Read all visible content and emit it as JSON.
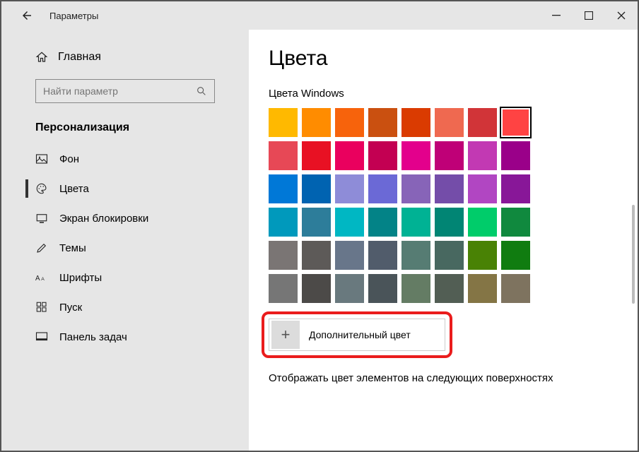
{
  "titlebar": {
    "title": "Параметры"
  },
  "sidebar": {
    "home": "Главная",
    "search_placeholder": "Найти параметр",
    "section": "Персонализация",
    "items": [
      {
        "label": "Фон"
      },
      {
        "label": "Цвета"
      },
      {
        "label": "Экран блокировки"
      },
      {
        "label": "Темы"
      },
      {
        "label": "Шрифты"
      },
      {
        "label": "Пуск"
      },
      {
        "label": "Панель задач"
      }
    ]
  },
  "main": {
    "title": "Цвета",
    "swatch_heading": "Цвета Windows",
    "custom_color": "Дополнительный цвет",
    "footer": "Отображать цвет элементов на следующих поверхностях"
  },
  "colors": {
    "rows": [
      [
        "#ffb900",
        "#ff8c00",
        "#f7630c",
        "#ca5010",
        "#da3b01",
        "#ef6950",
        "#d13438",
        "#ff4343"
      ],
      [
        "#e74856",
        "#e81123",
        "#ea005e",
        "#c30052",
        "#e3008c",
        "#bf0077",
        "#c239b3",
        "#9a0089"
      ],
      [
        "#0078d7",
        "#0063b1",
        "#8e8cd8",
        "#6b69d6",
        "#8764b8",
        "#744da9",
        "#b146c2",
        "#881798"
      ],
      [
        "#0099bc",
        "#2d7d9a",
        "#00b7c3",
        "#038387",
        "#00b294",
        "#018574",
        "#00cc6a",
        "#10893e"
      ],
      [
        "#7a7574",
        "#5d5a58",
        "#68768a",
        "#515c6b",
        "#567c73",
        "#486860",
        "#498205",
        "#107c10"
      ],
      [
        "#767676",
        "#4c4a48",
        "#69797e",
        "#4a5459",
        "#647c64",
        "#525e54",
        "#847545",
        "#7e735f"
      ]
    ],
    "selected": [
      0,
      7
    ]
  }
}
